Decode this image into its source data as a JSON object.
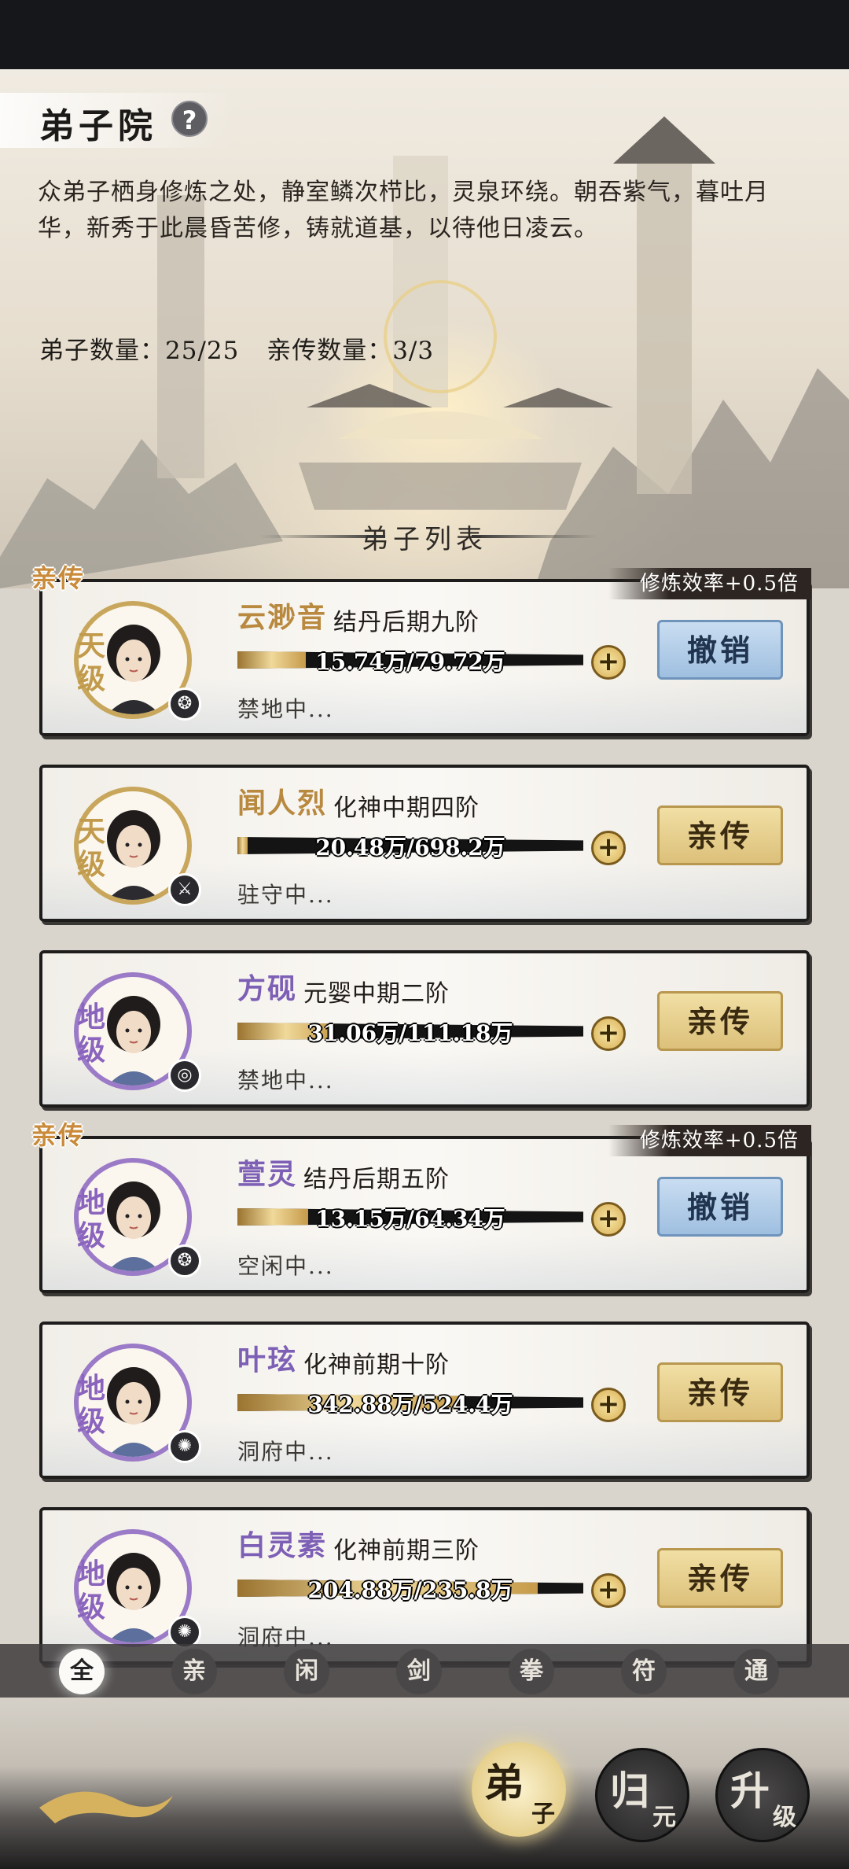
{
  "header": {
    "title": "弟子院",
    "help_icon": "?",
    "description": "众弟子栖身修炼之处，静室鳞次栉比，灵泉环绕。朝吞紫气，暮吐月华，新秀于此晨昏苦修，铸就道基，以待他日凌云。",
    "disciple_count_label": "弟子数量：25/25",
    "personal_count_label": "亲传数量：3/3",
    "list_title": "弟子列表"
  },
  "disciples": [
    {
      "tag": "亲传",
      "badge": "修炼效率+0.5倍",
      "grade": "天级",
      "grade_color": "gold",
      "name": "云渺音",
      "realm": "结丹后期九阶",
      "progress_text": "15.74万/79.72万",
      "progress": 0.197,
      "status": "禁地中...",
      "button": "撤销",
      "button_style": "blue",
      "element_icon": "fire-element-icon",
      "element_glyph": "❂"
    },
    {
      "tag": "",
      "badge": "",
      "grade": "天级",
      "grade_color": "gold",
      "name": "闻人烈",
      "realm": "化神中期四阶",
      "progress_text": "20.48万/698.2万",
      "progress": 0.029,
      "status": "驻守中...",
      "button": "亲传",
      "button_style": "gold",
      "element_icon": "sword-element-icon",
      "element_glyph": "⚔"
    },
    {
      "tag": "",
      "badge": "",
      "grade": "地级",
      "grade_color": "purple",
      "name": "方砚",
      "realm": "元婴中期二阶",
      "progress_text": "31.06万/111.18万",
      "progress": 0.279,
      "status": "禁地中...",
      "button": "亲传",
      "button_style": "gold",
      "element_icon": "spiral-element-icon",
      "element_glyph": "◎"
    },
    {
      "tag": "亲传",
      "badge": "修炼效率+0.5倍",
      "grade": "地级",
      "grade_color": "purple",
      "name": "萱灵",
      "realm": "结丹后期五阶",
      "progress_text": "13.15万/64.34万",
      "progress": 0.204,
      "status": "空闲中...",
      "button": "撤销",
      "button_style": "blue",
      "element_icon": "fire-element-icon",
      "element_glyph": "❂"
    },
    {
      "tag": "",
      "badge": "",
      "grade": "地级",
      "grade_color": "purple",
      "name": "叶玹",
      "realm": "化神前期十阶",
      "progress_text": "342.88万/524.4万",
      "progress": 0.654,
      "status": "洞府中...",
      "button": "亲传",
      "button_style": "gold",
      "element_icon": "swirl-element-icon",
      "element_glyph": "✺"
    },
    {
      "tag": "",
      "badge": "",
      "grade": "地级",
      "grade_color": "purple",
      "name": "白灵素",
      "realm": "化神前期三阶",
      "progress_text": "204.88万/235.8万",
      "progress": 0.869,
      "status": "洞府中...",
      "button": "亲传",
      "button_style": "gold",
      "element_icon": "swirl-element-icon",
      "element_glyph": "✺"
    }
  ],
  "filter_tabs": [
    "全",
    "亲",
    "闲",
    "剑",
    "拳",
    "符",
    "通"
  ],
  "active_tab": 0,
  "bottom_nav": [
    {
      "big": "弟",
      "small": "子",
      "active": true
    },
    {
      "big": "归",
      "small": "元",
      "active": false
    },
    {
      "big": "升",
      "small": "级",
      "active": false
    }
  ]
}
